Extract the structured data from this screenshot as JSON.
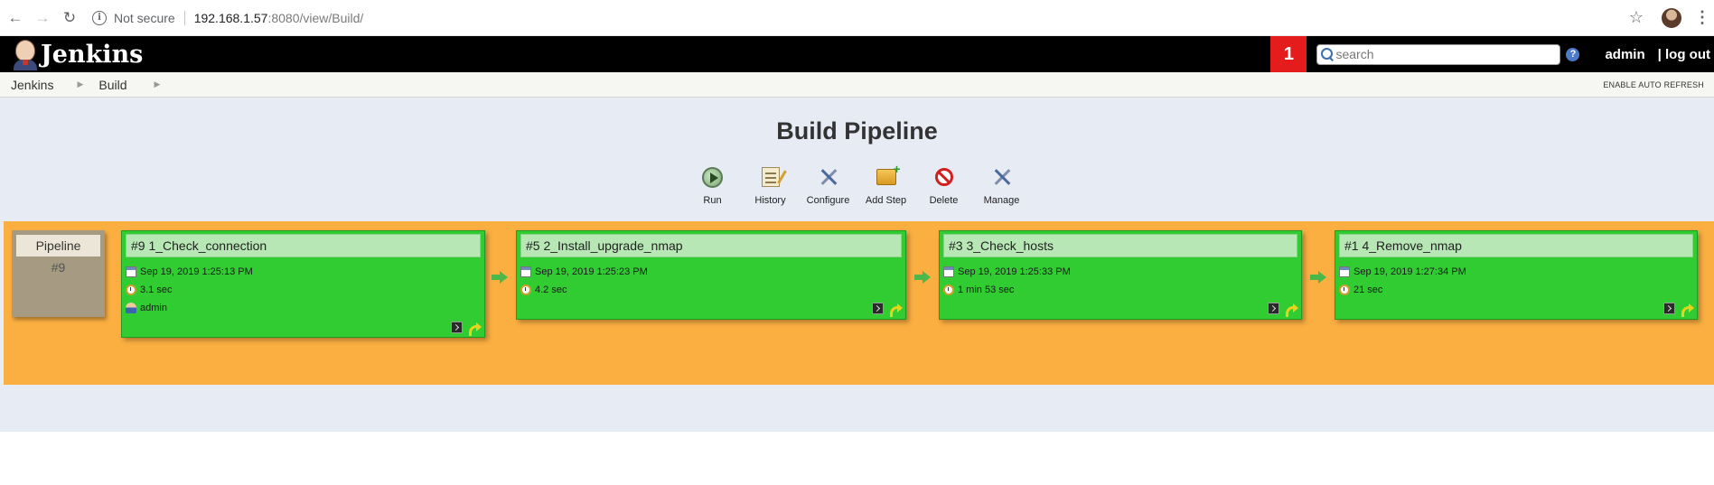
{
  "browser": {
    "security_label": "Not secure",
    "url_host": "192.168.1.57",
    "url_rest": ":8080/view/Build/",
    "icons": [
      "back-icon",
      "forward-icon",
      "reload-icon",
      "info-icon",
      "star-icon",
      "profile-avatar",
      "menu-icon"
    ]
  },
  "header": {
    "title": "Jenkins",
    "notification_count": "1",
    "search_placeholder": "search",
    "user": "admin",
    "logout": "| log out",
    "help": "?"
  },
  "breadcrumb": {
    "items": [
      "Jenkins",
      "Build"
    ],
    "auto_refresh": "ENABLE AUTO REFRESH"
  },
  "page": {
    "title": "Build Pipeline",
    "actions": [
      {
        "label": "Run",
        "icon": "run-icon"
      },
      {
        "label": "History",
        "icon": "history-icon"
      },
      {
        "label": "Configure",
        "icon": "configure-icon"
      },
      {
        "label": "Add Step",
        "icon": "add-step-icon"
      },
      {
        "label": "Delete",
        "icon": "delete-icon"
      },
      {
        "label": "Manage",
        "icon": "manage-icon"
      }
    ]
  },
  "pipeline": {
    "label": "Pipeline",
    "number": "#9",
    "stages": [
      {
        "title": "#9 1_Check_connection",
        "date": "Sep 19, 2019 1:25:13 PM",
        "duration": "3.1 sec",
        "user": "admin",
        "status": "success"
      },
      {
        "title": "#5 2_Install_upgrade_nmap",
        "date": "Sep 19, 2019 1:25:23 PM",
        "duration": "4.2 sec",
        "status": "success"
      },
      {
        "title": "#3 3_Check_hosts",
        "date": "Sep 19, 2019 1:25:33 PM",
        "duration": "1 min 53 sec",
        "status": "success"
      },
      {
        "title": "#1 4_Remove_nmap",
        "date": "Sep 19, 2019 1:27:34 PM",
        "duration": "21 sec",
        "status": "success"
      }
    ]
  },
  "colors": {
    "header_bg": "#000000",
    "notification_bg": "#e51c1c",
    "main_bg": "#e6ebf4",
    "pipeline_bg": "#fbaf41",
    "stage_success": "#31cb32"
  }
}
